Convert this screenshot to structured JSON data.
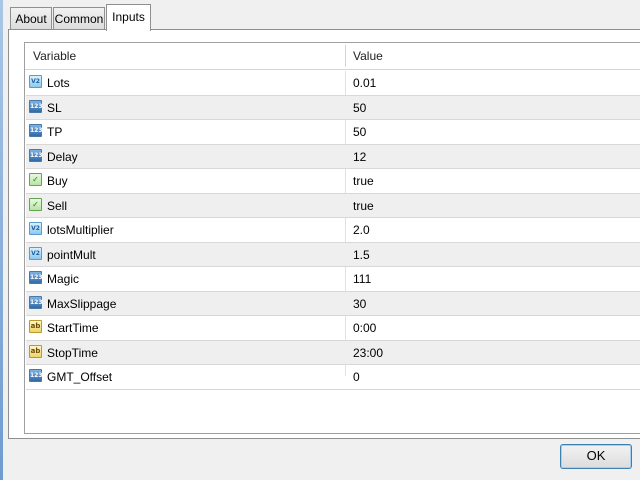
{
  "tabs": [
    {
      "label": "About"
    },
    {
      "label": "Common"
    },
    {
      "label": "Inputs"
    }
  ],
  "active_tab": "Inputs",
  "table": {
    "headers": {
      "variable": "Variable",
      "value": "Value"
    },
    "rows": [
      {
        "icon": "double-type-icon",
        "icon_text": "V2",
        "name": "Lots",
        "value": "0.01"
      },
      {
        "icon": "integer-type-icon",
        "icon_text": "123",
        "name": "SL",
        "value": "50"
      },
      {
        "icon": "integer-type-icon",
        "icon_text": "123",
        "name": "TP",
        "value": "50"
      },
      {
        "icon": "integer-type-icon",
        "icon_text": "123",
        "name": "Delay",
        "value": "12"
      },
      {
        "icon": "boolean-type-icon",
        "icon_text": "✓",
        "name": "Buy",
        "value": "true"
      },
      {
        "icon": "boolean-type-icon",
        "icon_text": "✓",
        "name": "Sell",
        "value": "true"
      },
      {
        "icon": "double-type-icon",
        "icon_text": "V2",
        "name": "lotsMultiplier",
        "value": "2.0"
      },
      {
        "icon": "double-type-icon",
        "icon_text": "V2",
        "name": "pointMult",
        "value": "1.5"
      },
      {
        "icon": "integer-type-icon",
        "icon_text": "123",
        "name": "Magic",
        "value": "111"
      },
      {
        "icon": "integer-type-icon",
        "icon_text": "123",
        "name": "MaxSlippage",
        "value": "30"
      },
      {
        "icon": "string-type-icon",
        "icon_text": "ab",
        "name": "StartTime",
        "value": "0:00"
      },
      {
        "icon": "string-type-icon",
        "icon_text": "ab",
        "name": "StopTime",
        "value": "23:00"
      },
      {
        "icon": "integer-type-icon",
        "icon_text": "123",
        "name": "GMT_Offset",
        "value": "0"
      }
    ]
  },
  "buttons": {
    "ok": "OK"
  },
  "colors": {
    "focus_border": "#3c7fb1",
    "row_alt": "#efefef"
  }
}
